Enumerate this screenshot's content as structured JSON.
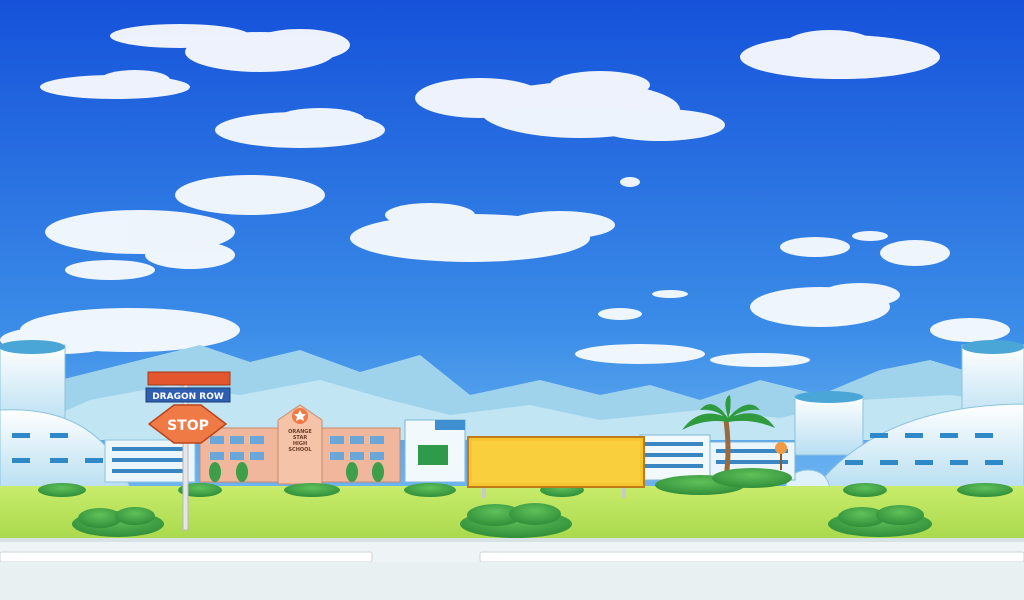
{
  "scene": {
    "street_sign": "DRAGON ROW",
    "stop_sign": "STOP",
    "school_sign": [
      "ORANGE",
      "STAR",
      "HIGH",
      "SCHOOL"
    ],
    "billboard": ""
  },
  "colors": {
    "sky_top": "#1a5fe0",
    "sky_bottom": "#7fc6f4",
    "mountains": "#a8d8ee",
    "grass": "#b6e25a",
    "road": "#e7eef0",
    "billboard": "#f6c531",
    "stop": "#f07a45",
    "street_sign": "#2e5fb0",
    "school": "#f1b79c"
  }
}
